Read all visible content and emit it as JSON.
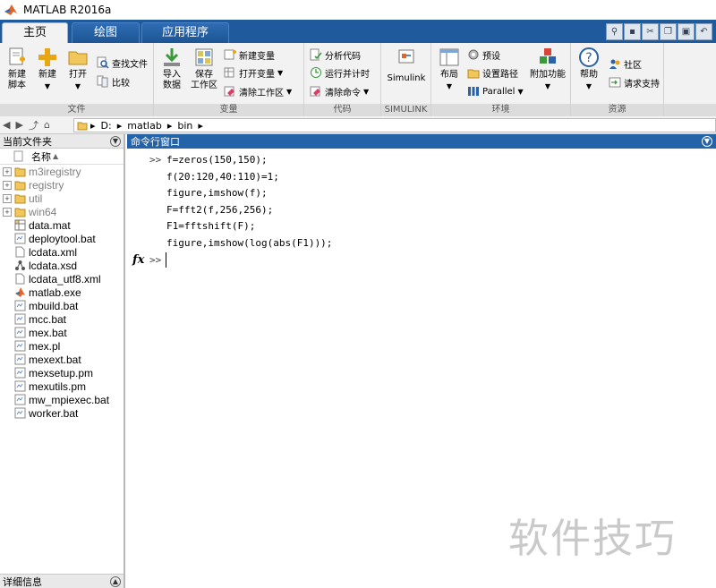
{
  "window": {
    "title": "MATLAB R2016a"
  },
  "tabs": [
    {
      "label": "主页",
      "active": true
    },
    {
      "label": "绘图",
      "active": false
    },
    {
      "label": "应用程序",
      "active": false
    }
  ],
  "ribbon": {
    "file": {
      "label": "文件",
      "new_script": "新建\n脚本",
      "new": "新建",
      "open": "打开",
      "find_files": "查找文件",
      "compare": "比较"
    },
    "variable": {
      "label": "变量",
      "import": "导入\n数据",
      "save_workspace": "保存\n工作区",
      "new_variable": "新建变量",
      "open_variable": "打开变量",
      "clear_workspace": "清除工作区"
    },
    "code": {
      "label": "代码",
      "analyze": "分析代码",
      "run_time": "运行并计时",
      "clear_commands": "清除命令"
    },
    "simulink": {
      "label": "SIMULINK",
      "button": "Simulink"
    },
    "environment": {
      "label": "环境",
      "layout": "布局",
      "preferences": "预设",
      "set_path": "设置路径",
      "parallel": "Parallel",
      "addons": "附加功能"
    },
    "resources": {
      "label": "资源",
      "help": "帮助",
      "community": "社区",
      "support": "请求支持"
    }
  },
  "address": {
    "drive": "D:",
    "segments": [
      "matlab",
      "bin"
    ]
  },
  "current_folder": {
    "title": "当前文件夹",
    "column_name": "名称",
    "sort_indicator": "▲",
    "items": [
      {
        "name": "m3iregistry",
        "type": "folder"
      },
      {
        "name": "registry",
        "type": "folder"
      },
      {
        "name": "util",
        "type": "folder"
      },
      {
        "name": "win64",
        "type": "folder"
      },
      {
        "name": "data.mat",
        "type": "mat"
      },
      {
        "name": "deploytool.bat",
        "type": "bat"
      },
      {
        "name": "lcdata.xml",
        "type": "xml"
      },
      {
        "name": "lcdata.xsd",
        "type": "xsd"
      },
      {
        "name": "lcdata_utf8.xml",
        "type": "xml"
      },
      {
        "name": "matlab.exe",
        "type": "exe"
      },
      {
        "name": "mbuild.bat",
        "type": "bat"
      },
      {
        "name": "mcc.bat",
        "type": "bat"
      },
      {
        "name": "mex.bat",
        "type": "bat"
      },
      {
        "name": "mex.pl",
        "type": "bat"
      },
      {
        "name": "mexext.bat",
        "type": "bat"
      },
      {
        "name": "mexsetup.pm",
        "type": "bat"
      },
      {
        "name": "mexutils.pm",
        "type": "bat"
      },
      {
        "name": "mw_mpiexec.bat",
        "type": "bat"
      },
      {
        "name": "worker.bat",
        "type": "bat"
      }
    ],
    "details_label": "详细信息"
  },
  "command_window": {
    "title": "命令行窗口",
    "prompt": ">>",
    "lines": [
      "f=zeros(150,150);",
      "f(20:120,40:110)=1;",
      "figure,imshow(f);",
      "F=fft2(f,256,256);",
      "F1=fftshift(F);",
      "figure,imshow(log(abs(F1)));"
    ],
    "fx_label": "fx"
  },
  "watermark": "软件技巧",
  "colors": {
    "tab_bar": "#1f5a9c",
    "ribbon_bg": "#f2f2f2",
    "cmd_header": "#2563a9"
  }
}
